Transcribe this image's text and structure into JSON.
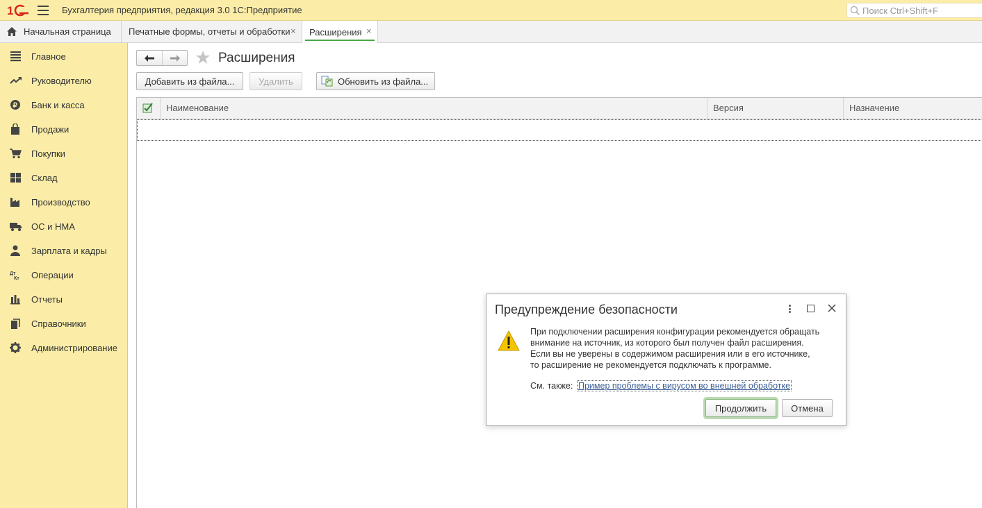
{
  "app": {
    "title": "Бухгалтерия предприятия, редакция 3.0 1С:Предприятие",
    "logo_text": "1С",
    "search_placeholder": "Поиск Ctrl+Shift+F"
  },
  "tabs": [
    {
      "label": "Начальная страница",
      "icon": "home-icon"
    },
    {
      "label": "Печатные формы, отчеты и обработки",
      "close": "×"
    },
    {
      "label": "Расширения",
      "close": "×",
      "active": true
    }
  ],
  "sidebar": {
    "items": [
      {
        "label": "Главное",
        "icon": "menu-lines-icon"
      },
      {
        "label": "Руководителю",
        "icon": "trend-icon"
      },
      {
        "label": "Банк и касса",
        "icon": "ruble-coin-icon"
      },
      {
        "label": "Продажи",
        "icon": "shopping-bag-icon"
      },
      {
        "label": "Покупки",
        "icon": "cart-icon"
      },
      {
        "label": "Склад",
        "icon": "warehouse-grid-icon"
      },
      {
        "label": "Производство",
        "icon": "factory-icon"
      },
      {
        "label": "ОС и НМА",
        "icon": "truck-icon"
      },
      {
        "label": "Зарплата и кадры",
        "icon": "person-icon"
      },
      {
        "label": "Операции",
        "icon": "debit-credit-icon"
      },
      {
        "label": "Отчеты",
        "icon": "bar-chart-icon"
      },
      {
        "label": "Справочники",
        "icon": "books-icon"
      },
      {
        "label": "Администрирование",
        "icon": "gear-icon"
      }
    ]
  },
  "page": {
    "title": "Расширения",
    "toolbar": {
      "add_label": "Добавить из файла...",
      "delete_label": "Удалить",
      "update_label": "Обновить из файла..."
    },
    "table": {
      "columns": [
        "Наименование",
        "Версия",
        "Назначение"
      ],
      "rows": []
    }
  },
  "dialog": {
    "title": "Предупреждение безопасности",
    "message_lines": [
      "При подключении расширения конфигурации рекомендуется обращать",
      "внимание на источник, из которого был получен файл расширения.",
      "Если вы не уверены в содержимом расширения или в его источнике,",
      "то расширение не рекомендуется подключать к программе."
    ],
    "see_also_label": "См. также:",
    "link_text": "Пример проблемы с вирусом во внешней обработке",
    "continue_label": "Продолжить",
    "cancel_label": "Отмена"
  },
  "colors": {
    "sidebar_bg": "#fbeda8",
    "active_tab_underline": "#4aa84a",
    "link": "#3a5e97"
  }
}
